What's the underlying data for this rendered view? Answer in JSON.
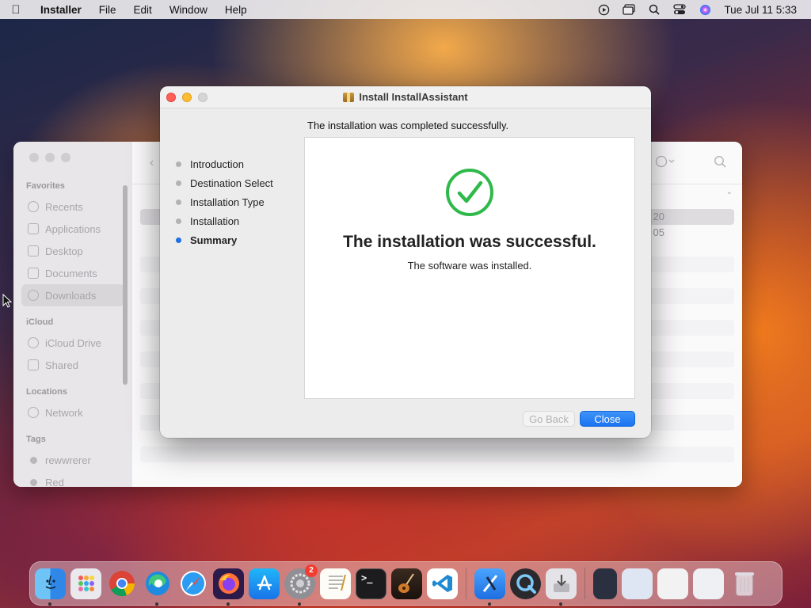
{
  "menubar": {
    "app_name": "Installer",
    "menus": [
      "File",
      "Edit",
      "Window",
      "Help"
    ],
    "clock": "Tue Jul 11  5:33"
  },
  "finder": {
    "sidebar": {
      "favorites_label": "Favorites",
      "favorites": [
        "Recents",
        "Applications",
        "Desktop",
        "Documents",
        "Downloads"
      ],
      "icloud_label": "iCloud",
      "icloud": [
        "iCloud Drive",
        "Shared"
      ],
      "locations_label": "Locations",
      "locations": [
        "Network"
      ],
      "tags_label": "Tags",
      "tags": [
        "rewwrerer",
        "Red"
      ]
    },
    "rows": [
      "20",
      "05"
    ]
  },
  "installer": {
    "title": "Install InstallAssistant",
    "header": "The installation was completed successfully.",
    "steps": [
      "Introduction",
      "Destination Select",
      "Installation Type",
      "Installation",
      "Summary"
    ],
    "current_step": "Summary",
    "success_title": "The installation was successful.",
    "success_subtitle": "The software was installed.",
    "go_back_label": "Go Back",
    "close_label": "Close",
    "accent_color": "#1f6fe0",
    "check_color": "#2fb94a"
  },
  "dock": {
    "badge_count": "2",
    "apps": [
      "finder-icon",
      "launchpad-icon",
      "chrome-icon",
      "edge-icon",
      "safari-icon",
      "firefox-icon",
      "app-store-icon",
      "system-settings-icon",
      "textedit-icon",
      "terminal-icon",
      "instruments-icon",
      "vscode-icon",
      "xcode-icon",
      "quicktime-icon",
      "installer-icon",
      "trash-icon"
    ]
  }
}
